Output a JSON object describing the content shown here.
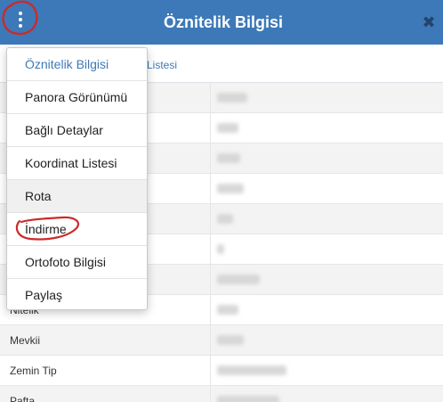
{
  "header": {
    "title": "Öznitelik Bilgisi",
    "menu_icon": "kebab-vertical-icon",
    "close_icon": "close-icon",
    "close_glyph": "✖"
  },
  "tabs": {
    "partial_label": "Listesi"
  },
  "menu": {
    "items": [
      {
        "label": "Öznitelik Bilgisi",
        "state": "active"
      },
      {
        "label": "Panora Görünümü"
      },
      {
        "label": "Bağlı Detaylar"
      },
      {
        "label": "Koordinat Listesi"
      },
      {
        "label": "Rota",
        "state": "hover"
      },
      {
        "label": "İndirme",
        "annotated": true
      },
      {
        "label": "Ortofoto Bilgisi"
      },
      {
        "label": "Paylaş"
      }
    ]
  },
  "table": {
    "rows": [
      {
        "label": ""
      },
      {
        "label": ""
      },
      {
        "label": ""
      },
      {
        "label": ""
      },
      {
        "label": ""
      },
      {
        "label": ""
      },
      {
        "label": ""
      },
      {
        "label": "Nitelik"
      },
      {
        "label": "Mevkii"
      },
      {
        "label": "Zemin Tip"
      },
      {
        "label": "Pafta"
      }
    ]
  },
  "colors": {
    "header_bg": "#3d79b8",
    "accent": "#3d79b8",
    "annotation": "#cc2a2a"
  }
}
